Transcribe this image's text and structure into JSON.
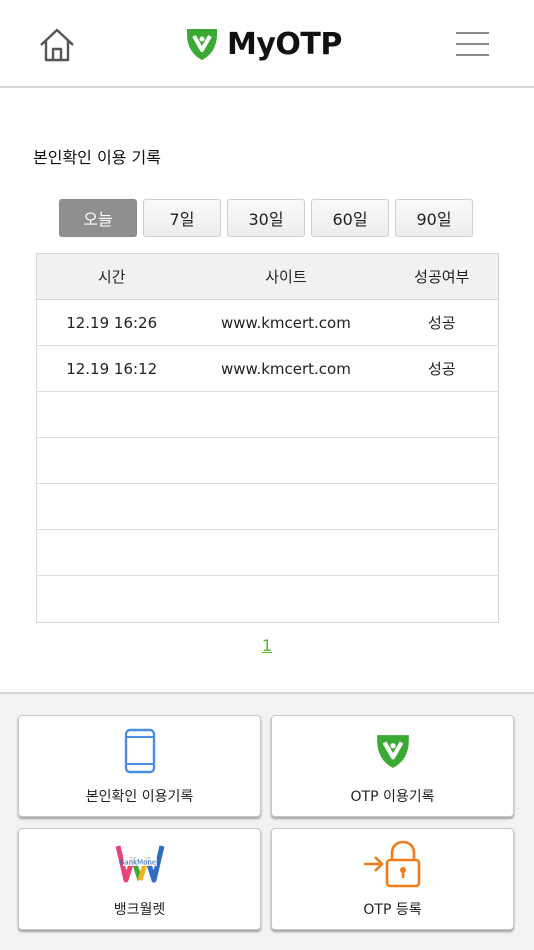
{
  "header": {
    "brand": "MyOTP",
    "brand_color": "#3aaa35",
    "home_icon": "home-icon",
    "menu_icon": "hamburger-menu-icon"
  },
  "section": {
    "title": "본인확인 이용 기록"
  },
  "period_tabs": [
    {
      "label": "오늘",
      "active": true
    },
    {
      "label": "7일",
      "active": false
    },
    {
      "label": "30일",
      "active": false
    },
    {
      "label": "60일",
      "active": false
    },
    {
      "label": "90일",
      "active": false
    }
  ],
  "table": {
    "headers": [
      "시간",
      "사이트",
      "성공여부"
    ],
    "rows": [
      [
        "12.19 16:26",
        "www.kmcert.com",
        "성공"
      ],
      [
        "12.19 16:12",
        "www.kmcert.com",
        "성공"
      ],
      [
        "",
        "",
        ""
      ],
      [
        "",
        "",
        ""
      ],
      [
        "",
        "",
        ""
      ],
      [
        "",
        "",
        ""
      ],
      [
        "",
        "",
        ""
      ]
    ]
  },
  "pagination": {
    "current": "1"
  },
  "quick_menu": [
    {
      "label": "본인확인 이용기록",
      "icon": "smartphone-icon"
    },
    {
      "label": "OTP 이용기록",
      "icon": "otp-shield-icon"
    },
    {
      "label": "뱅크월렛",
      "icon": "bankwallet-logo-icon",
      "logo_text": "BankMoney"
    },
    {
      "label": "OTP 등록",
      "icon": "lock-register-icon"
    }
  ],
  "colors": {
    "accent_green": "#3aaa35",
    "page_link_green": "#5cb531",
    "phone_blue": "#4a8fe0",
    "lock_orange": "#f07d1a",
    "active_tab": "#8f8f8f"
  }
}
